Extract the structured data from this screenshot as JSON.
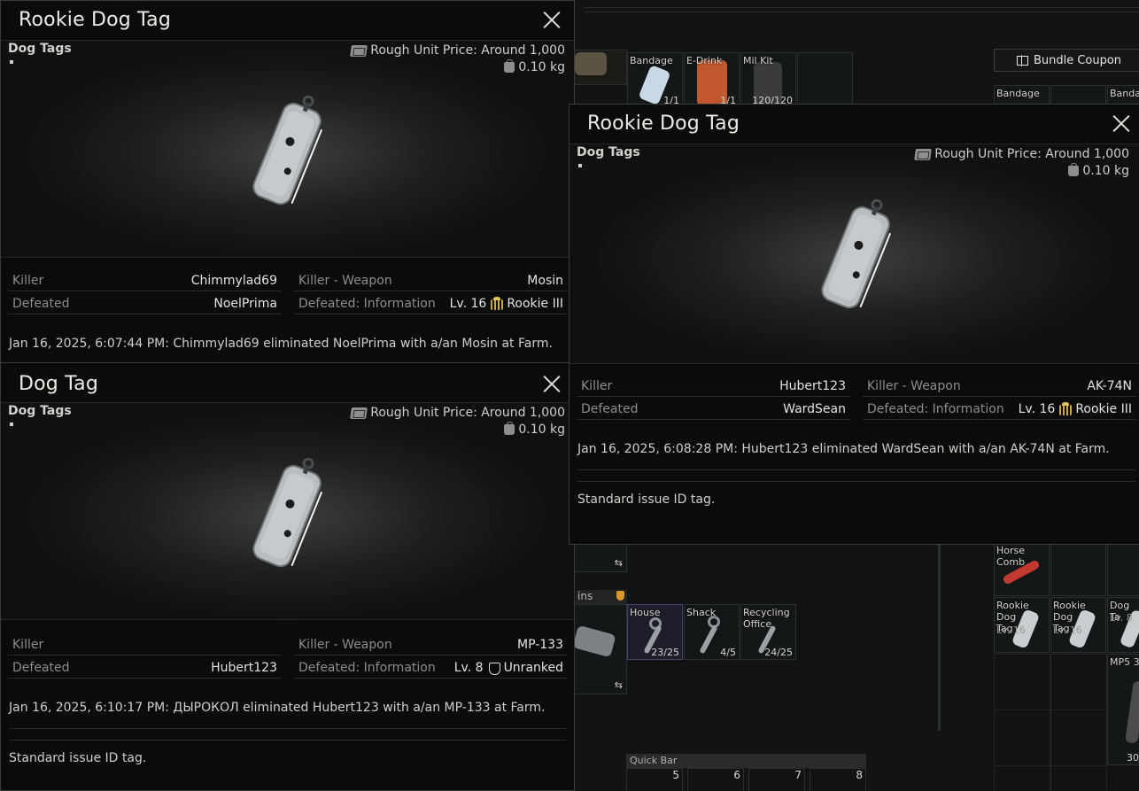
{
  "windows": [
    {
      "title": "Rookie Dog Tag",
      "category": "Dog Tags",
      "price": "Rough Unit Price: Around 1,000",
      "weight": "0.10 kg",
      "killer_label": "Killer",
      "killer": "Chimmylad69",
      "weapon_label": "Killer - Weapon",
      "weapon": "Mosin",
      "defeated_label": "Defeated",
      "defeated": "NoelPrima",
      "info_label": "Defeated: Information",
      "level": "Lv. 16",
      "rank": "Rookie III",
      "rank_icon": "rookie-rank-icon",
      "log": "Jan 16, 2025, 6:07:44 PM: Chimmylad69 eliminated NoelPrima with a/an Mosin at Farm."
    },
    {
      "title": "Dog Tag",
      "category": "Dog Tags",
      "price": "Rough Unit Price: Around 1,000",
      "weight": "0.10 kg",
      "killer_label": "Killer",
      "killer": "",
      "weapon_label": "Killer - Weapon",
      "weapon": "MP-133",
      "defeated_label": "Defeated",
      "defeated": "Hubert123",
      "info_label": "Defeated: Information",
      "level": "Lv. 8",
      "rank": "Unranked",
      "rank_icon": "unranked-rank-icon",
      "log": "Jan 16, 2025, 6:10:17 PM: ДЫРОКОЛ eliminated Hubert123 with a/an MP-133 at Farm.",
      "description": "Standard issue ID tag."
    },
    {
      "title": "Rookie Dog Tag",
      "category": "Dog Tags",
      "price": "Rough Unit Price: Around 1,000",
      "weight": "0.10 kg",
      "killer_label": "Killer",
      "killer": "Hubert123",
      "weapon_label": "Killer - Weapon",
      "weapon": "AK-74N",
      "defeated_label": "Defeated",
      "defeated": "WardSean",
      "info_label": "Defeated: Information",
      "level": "Lv. 16",
      "rank": "Rookie III",
      "rank_icon": "rookie-rank-icon",
      "log": "Jan 16, 2025, 6:08:28 PM: Hubert123 eliminated WardSean with a/an AK-74N at Farm.",
      "description": "Standard issue ID tag."
    }
  ],
  "stash": {
    "bundle_button": "Bundle Coupon",
    "top_items": [
      {
        "name": "Bandage",
        "count": "1/1",
        "icon": "bandage-icon"
      },
      {
        "name": "E-Drink",
        "count": "1/1",
        "icon": "drink-can-icon"
      },
      {
        "name": "Mil Kit",
        "count": "120/120",
        "icon": "medkit-icon"
      }
    ],
    "right_top_items": [
      "Bandage",
      "Bandag"
    ],
    "keys_label": "ins",
    "keys": [
      {
        "name": "House",
        "count": "23/25"
      },
      {
        "name": "Shack",
        "count": "4/5"
      },
      {
        "name": "Recycling Office",
        "count": "24/25"
      }
    ],
    "right_items": [
      {
        "name": "Horse Comb",
        "lvl": ""
      },
      {
        "name": "Rookie Dog Tag",
        "lvl": "Lv. 16"
      },
      {
        "name": "Rookie Dog Tag",
        "lvl": "Lv. 16"
      },
      {
        "name": "Dog Ta",
        "lvl": "Lv. 8"
      },
      {
        "name": "MP5 3",
        "lvl": "30"
      }
    ],
    "quickbar_label": "Quick Bar",
    "quickbar_slots": [
      "5",
      "6",
      "7",
      "8"
    ]
  }
}
